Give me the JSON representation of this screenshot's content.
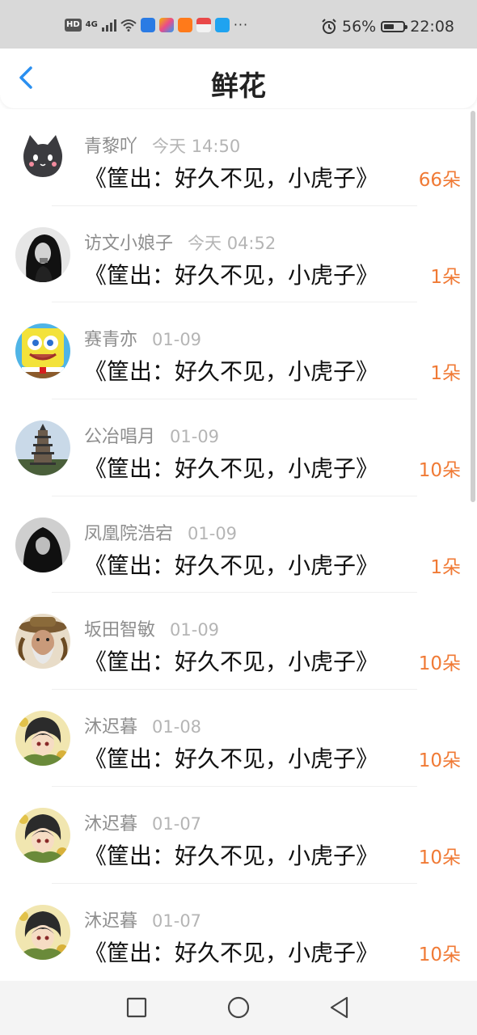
{
  "status_bar": {
    "hd": "HD",
    "network": "4G",
    "more": "···",
    "battery": "56%",
    "time": "22:08"
  },
  "header": {
    "title": "鲜花"
  },
  "colors": {
    "accent_blue": "#2a8ff0",
    "flower_count": "#f07a35"
  },
  "rows": [
    {
      "name": "青黎吖",
      "time": "今天 14:50",
      "book": "《筐出：好久不见，小虎子》",
      "count": "66朵",
      "avatar": "cat-avatar"
    },
    {
      "name": "访文小娘子",
      "time": "今天 04:52",
      "book": "《筐出：好久不见，小虎子》",
      "count": "1朵",
      "avatar": "bw-girl-avatar"
    },
    {
      "name": "赛青亦",
      "time": "01-09",
      "book": "《筐出：好久不见，小虎子》",
      "count": "1朵",
      "avatar": "spongebob-avatar"
    },
    {
      "name": "公冶唱月",
      "time": "01-09",
      "book": "《筐出：好久不见，小虎子》",
      "count": "10朵",
      "avatar": "pagoda-avatar"
    },
    {
      "name": "凤凰院浩宕",
      "time": "01-09",
      "book": "《筐出：好久不见，小虎子》",
      "count": "1朵",
      "avatar": "dark-portrait-avatar"
    },
    {
      "name": "坂田智敏",
      "time": "01-09",
      "book": "《筐出：好久不见，小虎子》",
      "count": "10朵",
      "avatar": "hat-man-avatar"
    },
    {
      "name": "沐迟暮",
      "time": "01-08",
      "book": "《筐出：好久不见，小虎子》",
      "count": "10朵",
      "avatar": "anime-avatar"
    },
    {
      "name": "沐迟暮",
      "time": "01-07",
      "book": "《筐出：好久不见，小虎子》",
      "count": "10朵",
      "avatar": "anime-avatar"
    },
    {
      "name": "沐迟暮",
      "time": "01-07",
      "book": "《筐出：好久不见，小虎子》",
      "count": "10朵",
      "avatar": "anime-avatar"
    }
  ]
}
